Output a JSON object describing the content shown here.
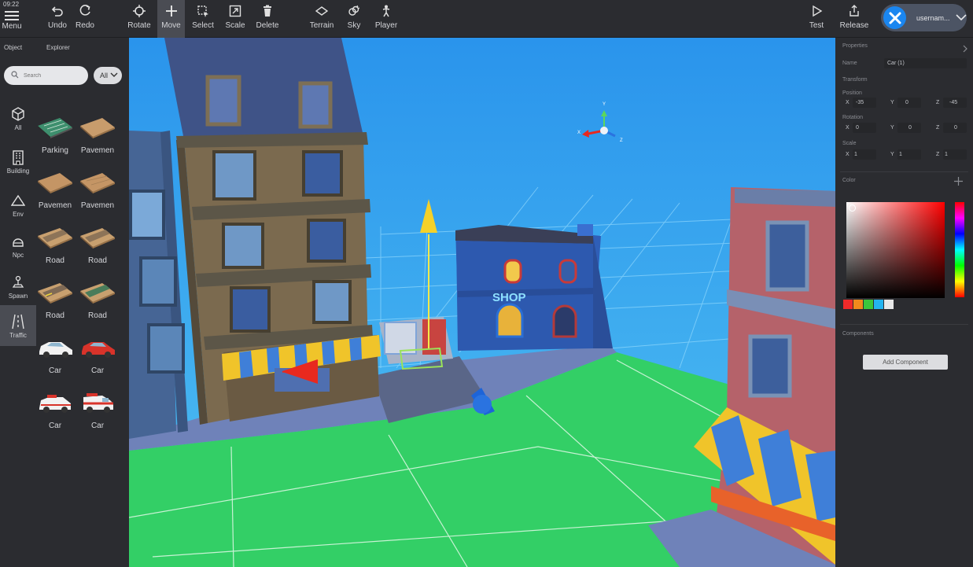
{
  "status": {
    "time": "09:22"
  },
  "toolbar": {
    "menu": "Menu",
    "undo": "Undo",
    "redo": "Redo",
    "rotate": "Rotate",
    "move": "Move",
    "select": "Select",
    "scale": "Scale",
    "delete": "Delete",
    "terrain": "Terrain",
    "sky": "Sky",
    "player": "Player",
    "test": "Test",
    "release": "Release",
    "username": "usernam..."
  },
  "left_panel": {
    "tabs": [
      "Object",
      "Explorer"
    ],
    "search_placeholder": "Search",
    "filter": "All",
    "categories": [
      {
        "label": "All",
        "icon": "cube-icon"
      },
      {
        "label": "Building",
        "icon": "building-icon"
      },
      {
        "label": "Env",
        "icon": "mountain-icon"
      },
      {
        "label": "Npc",
        "icon": "helmet-icon"
      },
      {
        "label": "Spawn",
        "icon": "spawn-point-icon"
      },
      {
        "label": "Traffic",
        "icon": "road-icon"
      }
    ],
    "assets": [
      "Parking",
      "Pavemen",
      "Pavemen",
      "Pavemen",
      "Road",
      "Road",
      "Road",
      "Road",
      "Car",
      "Car",
      "Car",
      "Car"
    ]
  },
  "properties": {
    "title": "Properties",
    "name_label": "Name",
    "name_value": "Car (1)",
    "transform_label": "Transform",
    "position_label": "Position",
    "position": {
      "x": "-35",
      "y": "0",
      "z": "-45"
    },
    "rotation_label": "Rotation",
    "rotation": {
      "x": "0",
      "y": "0",
      "z": "0"
    },
    "scale_label": "Scale",
    "scale": {
      "x": "1",
      "y": "1",
      "z": "1"
    },
    "color_label": "Color",
    "swatch_colors": [
      "#f02a2a",
      "#f08a1c",
      "#3cc63c",
      "#24b4f0",
      "#e8e8e8"
    ],
    "components_label": "Components",
    "add_component": "Add Component"
  },
  "viewport": {
    "shop_sign": "SHOP",
    "gizmo_axes": {
      "x": "X",
      "y": "Y",
      "z": "Z"
    }
  },
  "colors": {
    "panel": "#2b2c30",
    "active": "#4a4c53",
    "sky": "#3aa6ef",
    "ground": "#33cf66",
    "accent": "#1a86f0"
  }
}
